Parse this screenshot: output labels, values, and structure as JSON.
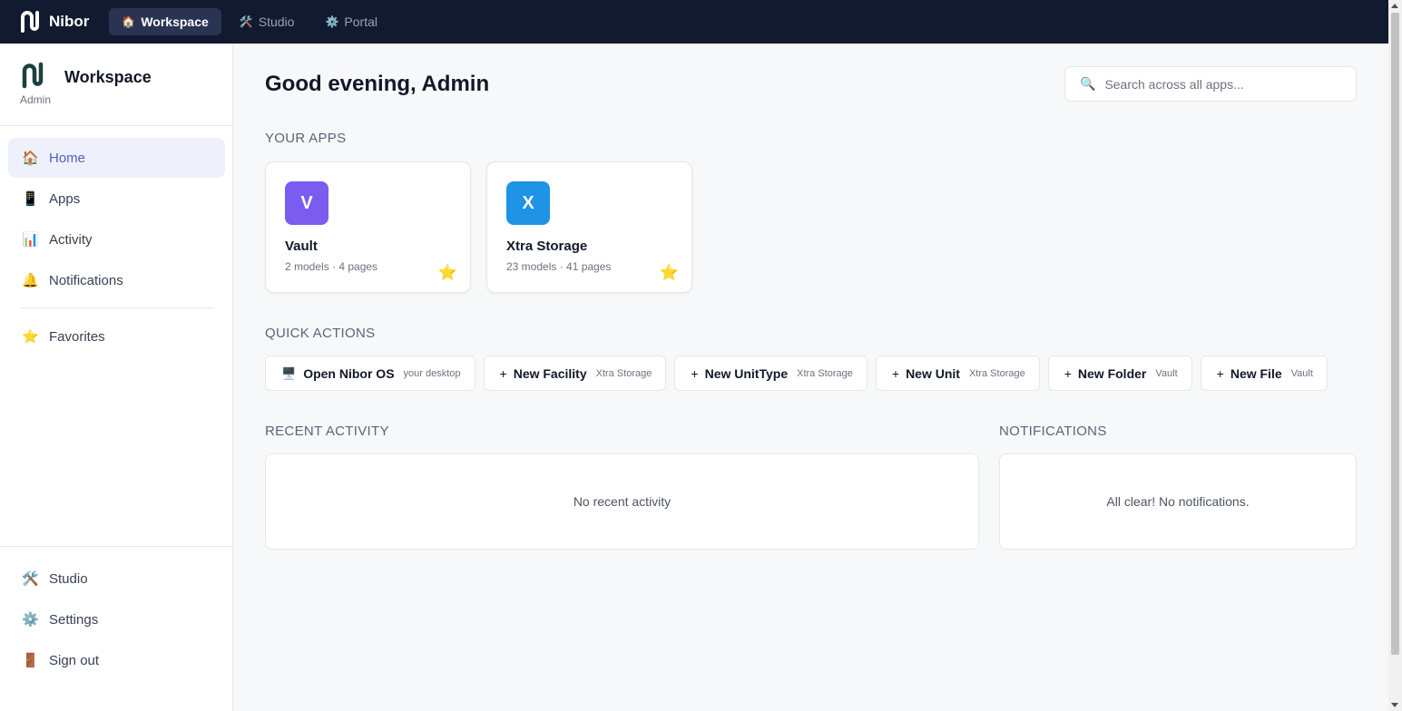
{
  "topbar": {
    "brand": "Nibor",
    "nav": [
      {
        "label": "Workspace",
        "icon": "🏠",
        "active": true
      },
      {
        "label": "Studio",
        "icon": "🛠️"
      },
      {
        "label": "Portal",
        "icon": "⚙️"
      }
    ]
  },
  "sidebar": {
    "title": "Workspace",
    "subtitle": "Admin",
    "items": [
      {
        "label": "Home",
        "icon": "🏠"
      },
      {
        "label": "Apps",
        "icon": "📱"
      },
      {
        "label": "Activity",
        "icon": "📊"
      },
      {
        "label": "Notifications",
        "icon": "🔔"
      },
      {
        "label": "Favorites",
        "icon": "⭐"
      }
    ],
    "footer": [
      {
        "label": "Studio",
        "icon": "🛠️"
      },
      {
        "label": "Settings",
        "icon": "⚙️"
      },
      {
        "label": "Sign out",
        "icon": "🚪"
      }
    ]
  },
  "main": {
    "greeting": "Good evening, Admin",
    "search_placeholder": "Search across all apps...",
    "search_icon": "🔍",
    "apps_title": "YOUR APPS",
    "apps": [
      {
        "letter": "V",
        "name": "Vault",
        "meta": "2 models · 4 pages",
        "color": "#7b5cf0",
        "star": "⭐"
      },
      {
        "letter": "X",
        "name": "Xtra Storage",
        "meta": "23 models · 41 pages",
        "color": "#1f93e6",
        "star": "⭐"
      }
    ],
    "quick_title": "QUICK ACTIONS",
    "quick_actions": [
      {
        "label": "Open Nibor OS",
        "tag": "your desktop",
        "icon": "🖥️"
      },
      {
        "label": "New Facility",
        "tag": "Xtra Storage",
        "icon": "+"
      },
      {
        "label": "New UnitType",
        "tag": "Xtra Storage",
        "icon": "+"
      },
      {
        "label": "New Unit",
        "tag": "Xtra Storage",
        "icon": "+"
      },
      {
        "label": "New Folder",
        "tag": "Vault",
        "icon": "+"
      },
      {
        "label": "New File",
        "tag": "Vault",
        "icon": "+"
      }
    ],
    "recent_title": "RECENT ACTIVITY",
    "recent_empty": "No recent activity",
    "notifications_title": "NOTIFICATIONS",
    "notifications_empty": "All clear! No notifications."
  },
  "colors": {
    "topbar_bg": "#111a2e",
    "accent": "#4f5fc2",
    "star": "#f5d775"
  }
}
